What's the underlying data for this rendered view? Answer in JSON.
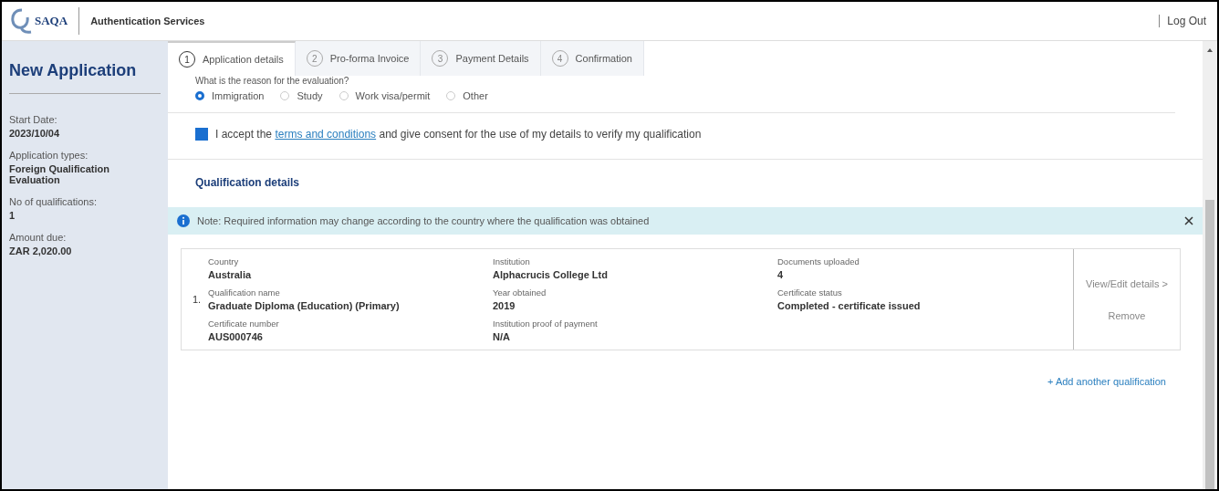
{
  "header": {
    "logo": "SAQA",
    "title": "Authentication Services",
    "logout": "Log Out"
  },
  "sidebar": {
    "title": "New Application",
    "fields": [
      {
        "label": "Start Date:",
        "value": "2023/10/04"
      },
      {
        "label": "Application types:",
        "value": "Foreign Qualification Evaluation"
      },
      {
        "label": "No of qualifications:",
        "value": "1"
      },
      {
        "label": "Amount due:",
        "value": "ZAR 2,020.00"
      }
    ]
  },
  "steps": [
    {
      "number": "1",
      "label": "Application details",
      "selected": true
    },
    {
      "number": "2",
      "label": "Pro-forma Invoice",
      "selected": false
    },
    {
      "number": "3",
      "label": "Payment Details",
      "selected": false
    },
    {
      "number": "4",
      "label": "Confirmation",
      "selected": false
    }
  ],
  "reason": {
    "question": "What is the reason for the evaluation?",
    "options": [
      {
        "label": "Immigration",
        "selected": true
      },
      {
        "label": "Study",
        "selected": false
      },
      {
        "label": "Work visa/permit",
        "selected": false
      },
      {
        "label": "Other",
        "selected": false
      }
    ]
  },
  "consent": {
    "checked": true,
    "before": "I accept the",
    "link": "terms and conditions",
    "after": "and give consent for the use of my details to verify my qualification"
  },
  "qualifications": {
    "title": "Qualification details",
    "note": "Note: Required information may change according to the country where the qualification was obtained",
    "items": [
      {
        "number": "1.",
        "fields": [
          {
            "label": "Country",
            "value": "Australia"
          },
          {
            "label": "Institution",
            "value": "Alphacrucis College Ltd"
          },
          {
            "label": "Documents uploaded",
            "value": "4"
          },
          {
            "label": "Qualification name",
            "value": "Graduate Diploma (Education) (Primary)"
          },
          {
            "label": "Year obtained",
            "value": "2019"
          },
          {
            "label": "Certificate status",
            "value": "Completed - certificate issued"
          },
          {
            "label": "Certificate number",
            "value": "AUS000746"
          },
          {
            "label": "Institution proof of payment",
            "value": "N/A"
          }
        ],
        "actions": [
          "View/Edit details >",
          "Remove"
        ]
      }
    ],
    "add": "+ Add another qualification"
  }
}
